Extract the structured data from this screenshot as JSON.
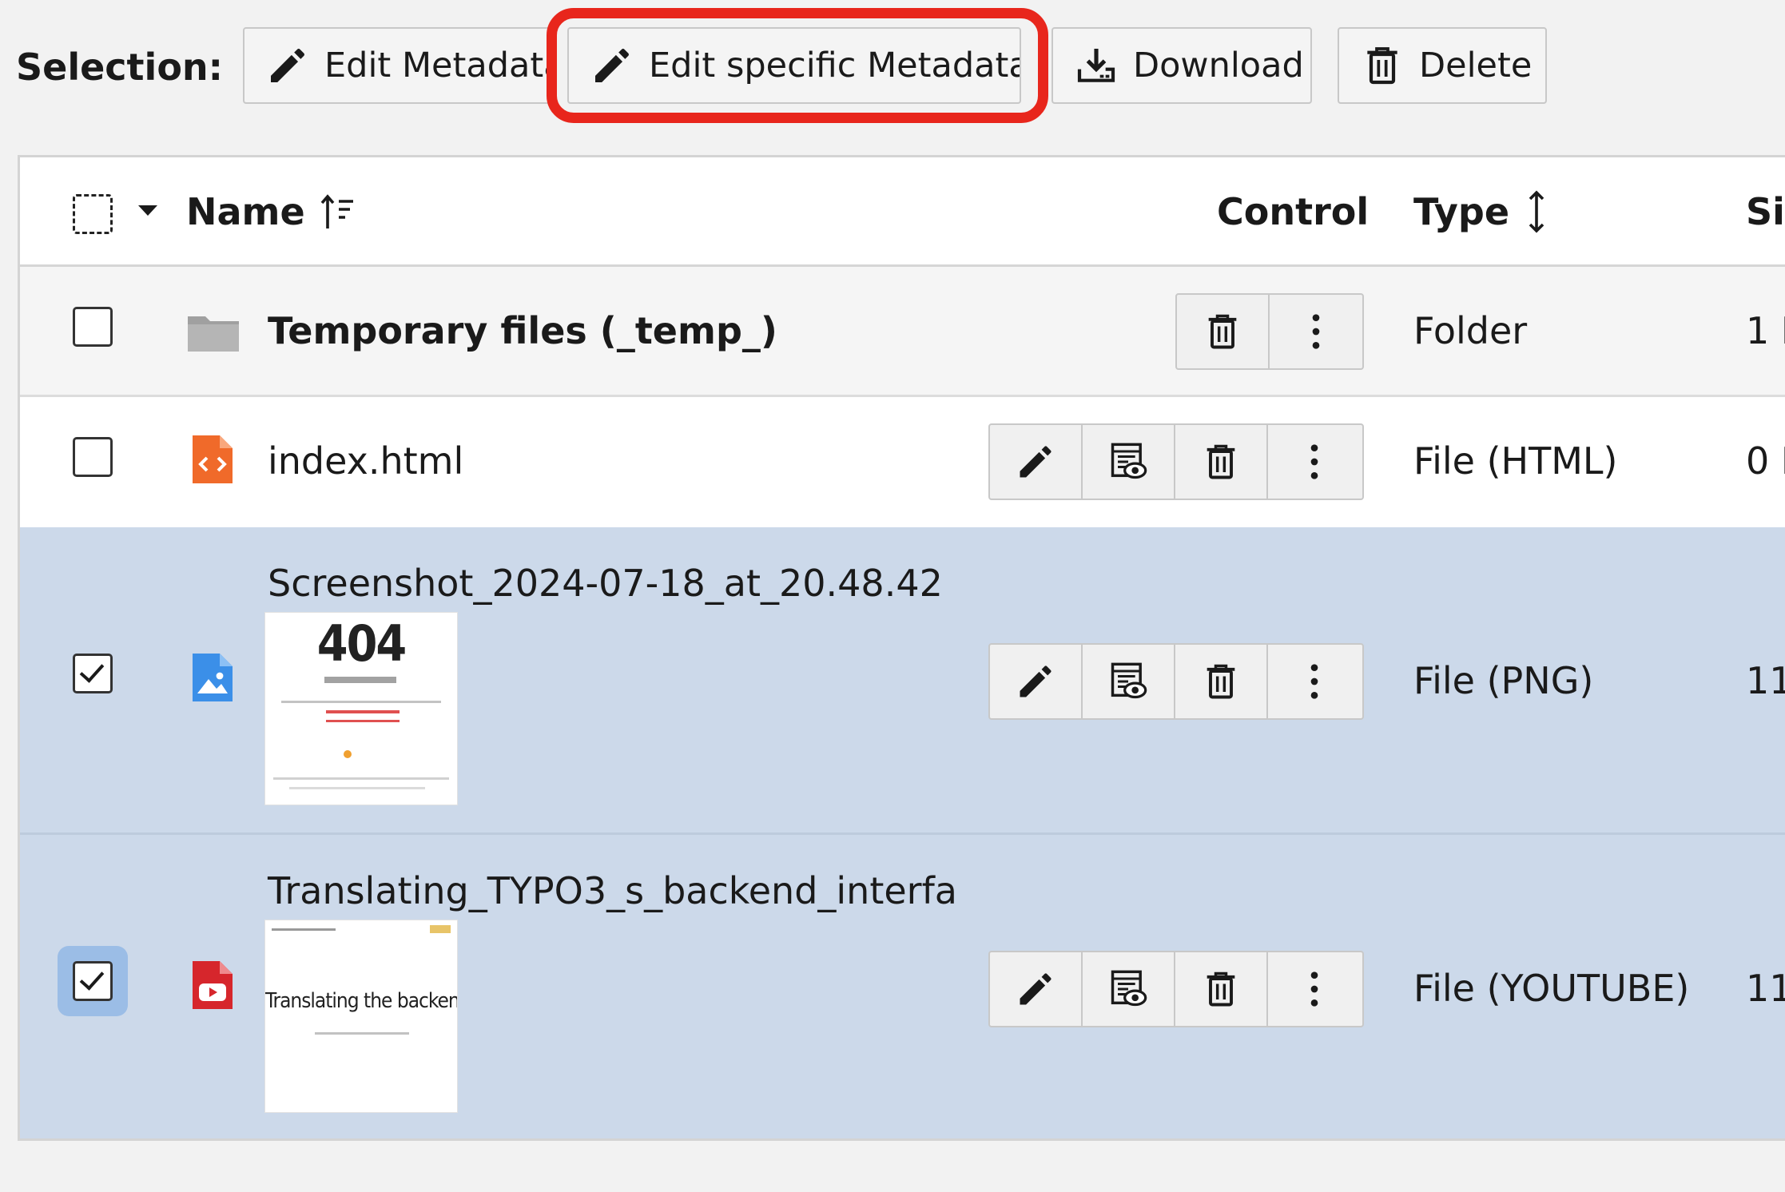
{
  "toolbar": {
    "selection_label": "Selection:",
    "edit_metadata_label": "Edit Metadata",
    "edit_specific_metadata_label": "Edit specific Metadata",
    "download_label": "Download",
    "delete_label": "Delete",
    "highlight_color": "#e8261c"
  },
  "table": {
    "columns": {
      "name": "Name",
      "control": "Control",
      "type": "Type",
      "size": "Si"
    },
    "rows": [
      {
        "name": "Temporary files (_temp_)",
        "type": "Folder",
        "size": "1 I",
        "checked": false,
        "icon": "folder-icon"
      },
      {
        "name": "index.html",
        "type": "File (HTML)",
        "size": "0 I",
        "checked": false,
        "icon": "html-file-icon"
      },
      {
        "name": "Screenshot_2024-07-18_at_20.48.42",
        "type": "File (PNG)",
        "size": "11",
        "checked": true,
        "icon": "image-file-icon",
        "thumbnail_text": "404"
      },
      {
        "name": "Translating_TYPO3_s_backend_interfa",
        "type": "File (YOUTUBE)",
        "size": "11",
        "checked": true,
        "icon": "youtube-file-icon",
        "thumbnail_text": "Translating the backend"
      }
    ]
  },
  "colors": {
    "selected_row": "#ccd9ea",
    "html_icon": "#f06a2a",
    "image_icon": "#3b8fe8",
    "youtube_icon": "#d6262c",
    "folder_icon": "#9a9a9a"
  }
}
